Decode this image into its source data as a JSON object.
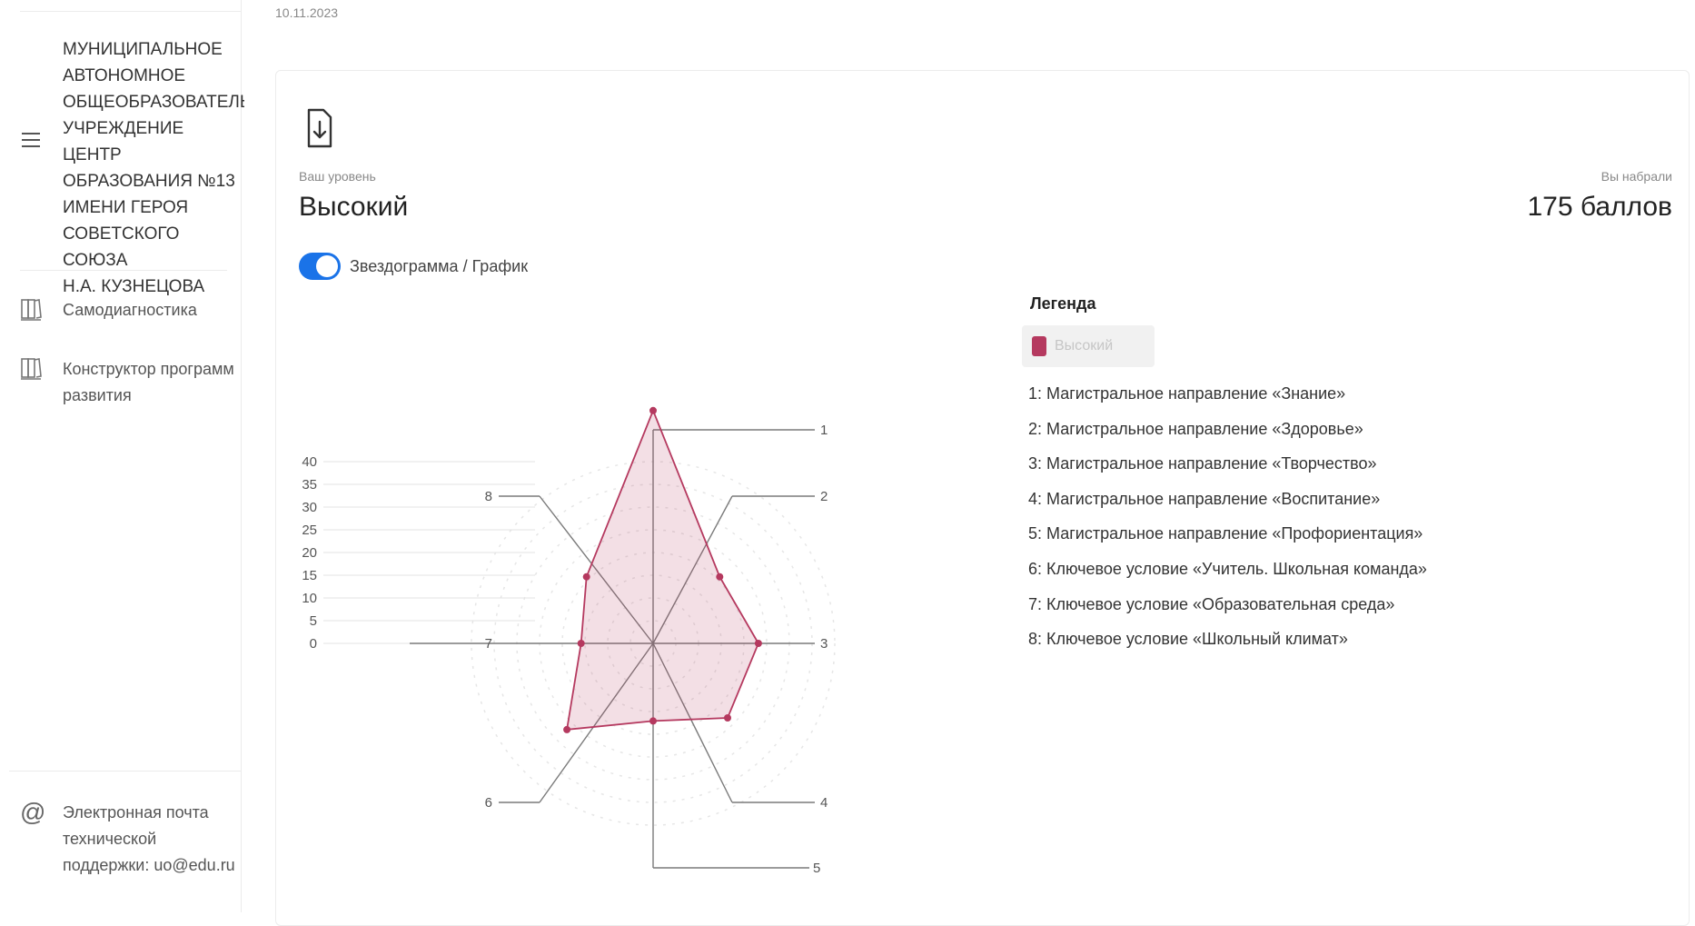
{
  "sidebar": {
    "org_name": "МУНИЦИПАЛЬНОЕ\nАВТОНОМНОЕ\nОБЩЕОБРАЗОВАТЕЛЬН\nУЧРЕЖДЕНИЕ ЦЕНТР\nОБРАЗОВАНИЯ №13\nИМЕНИ ГЕРОЯ\nСОВЕТСКОГО СОЮЗА\nН.А. КУЗНЕЦОВА",
    "menu_icon": "hamburger-icon",
    "nav": [
      {
        "label": "Самодиагностика",
        "icon": "book-icon"
      },
      {
        "label": "Конструктор программ развития",
        "icon": "book-icon"
      }
    ],
    "support": {
      "icon": "at-icon",
      "text": "Электронная почта технической поддержки: uo@edu.ru"
    }
  },
  "header": {
    "date": "10.11.2023"
  },
  "result": {
    "download_icon": "file-download-icon",
    "level_caption": "Ваш уровень",
    "level_value": "Высокий",
    "score_caption": "Вы набрали",
    "score_value": "175 баллов"
  },
  "toggle": {
    "label": "Звездограмма / График",
    "on": true
  },
  "legend": {
    "title": "Легенда",
    "series_label": "Высокий",
    "series_color": "#b5395f",
    "items": [
      "1: Магистральное направление «Знание»",
      "2: Магистральное направление «Здоровье»",
      "3: Магистральное направление «Творчество»",
      "4: Магистральное направление «Воспитание»",
      "5: Магистральное направление «Профориентация»",
      "6: Ключевое условие «Учитель. Школьная команда»",
      "7: Ключевое условие «Образовательная среда»",
      "8: Ключевое условие «Школьный климат»"
    ]
  },
  "chart_data": {
    "type": "radar",
    "categories": [
      "1",
      "2",
      "3",
      "4",
      "5",
      "6",
      "7",
      "8"
    ],
    "series": [
      {
        "name": "Высокий",
        "values": [
          42,
          17,
          19,
          19,
          14,
          22,
          13,
          17
        ]
      }
    ],
    "yticks": [
      0,
      5,
      10,
      15,
      20,
      25,
      30,
      35,
      40
    ],
    "ylim": [
      0,
      46
    ],
    "color": "#b5395f"
  }
}
